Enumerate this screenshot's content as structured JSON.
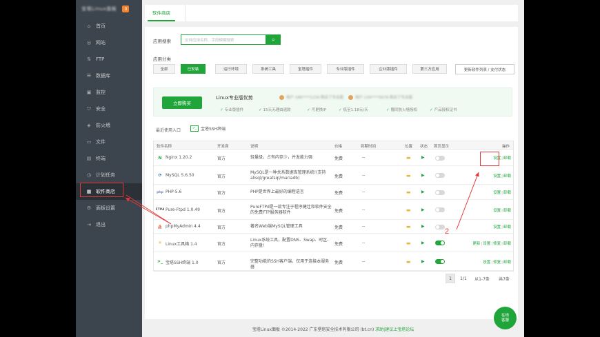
{
  "brand": {
    "name": "宝塔Linux面板",
    "badge": "0"
  },
  "sidebar": {
    "items": [
      {
        "label": "首页",
        "icon": "home-icon",
        "glyph": "⌂"
      },
      {
        "label": "网站",
        "icon": "globe-icon",
        "glyph": "◎"
      },
      {
        "label": "FTP",
        "icon": "ftp-icon",
        "glyph": "⇅"
      },
      {
        "label": "数据库",
        "icon": "database-icon",
        "glyph": "☰"
      },
      {
        "label": "监控",
        "icon": "monitor-icon",
        "glyph": "▣"
      },
      {
        "label": "安全",
        "icon": "shield-icon",
        "glyph": "⛉"
      },
      {
        "label": "防火墙",
        "icon": "firewall-icon",
        "glyph": "◈"
      },
      {
        "label": "文件",
        "icon": "folder-icon",
        "glyph": "▭"
      },
      {
        "label": "终端",
        "icon": "terminal-icon",
        "glyph": "▤"
      },
      {
        "label": "计划任务",
        "icon": "clock-icon",
        "glyph": "◷"
      },
      {
        "label": "软件商店",
        "icon": "apps-icon",
        "glyph": "▦"
      },
      {
        "label": "面板设置",
        "icon": "gear-icon",
        "glyph": "⚙"
      },
      {
        "label": "退出",
        "icon": "logout-icon",
        "glyph": "⇥"
      }
    ]
  },
  "tabs": {
    "active": "软件商店"
  },
  "search": {
    "label": "应用搜索",
    "placeholder": "支持应用名称、字段模糊搜索"
  },
  "categories": {
    "label": "应用分类",
    "items": [
      "全部",
      "已安装",
      "运行环境",
      "系统工具",
      "宝塔插件",
      "专业版插件",
      "企业版插件",
      "第三方应用"
    ],
    "active_index": 1,
    "update_button": "更新软件列表 / 支付状态"
  },
  "promo": {
    "buy_button": "立即购买",
    "title": "Linux专业版优势",
    "users": [
      "用户 186****1234 购买了专业版",
      "用户 139****5678 购买了专业版"
    ],
    "features": [
      "专业版插件",
      "15天无理由退款",
      "可更换IP",
      "低至1.18元/天",
      "赠同防火墙授权",
      "产品授权证书"
    ]
  },
  "recent": {
    "label": "最近使用入口",
    "item": "宝塔SSH终端",
    "icon_text": ">_"
  },
  "table": {
    "headers": [
      "软件名称",
      "开发商",
      "说明",
      "价格",
      "到期时间",
      "位置",
      "状态",
      "首页显示",
      "操作"
    ],
    "rows": [
      {
        "icon": "N",
        "icon_color": "#20a53a",
        "name": "Nginx 1.20.2",
        "dev": "官方",
        "desc": "轻量级，占有内存少，并发能力强",
        "price": "免费",
        "expire": "--",
        "display_on": false,
        "ops": [
          "设置",
          "卸载"
        ]
      },
      {
        "icon": "⟳",
        "icon_color": "#2a6ea6",
        "name": "MySQL 5.6.50",
        "dev": "官方",
        "desc": "MySQL是一种关系数据库管理系统!(支持alisql/greatsql/mariadb)",
        "price": "免费",
        "expire": "--",
        "display_on": false,
        "ops": [
          "设置",
          "卸载"
        ]
      },
      {
        "icon": "php",
        "icon_color": "#6c7eb7",
        "name": "PHP-5.6",
        "dev": "官方",
        "desc": "PHP是世界上最好的编程语言",
        "price": "免费",
        "expire": "--",
        "display_on": false,
        "ops": [
          "设置",
          "卸载"
        ]
      },
      {
        "icon": "FTPd",
        "icon_color": "#555555",
        "name": "Pure-Ftpd 1.0.49",
        "dev": "官方",
        "desc": "PureFTPd是一款专注于程序健壮和软件安全的免费FTP服务器软件",
        "price": "免费",
        "expire": "--",
        "display_on": false,
        "ops": [
          "设置",
          "卸载"
        ]
      },
      {
        "icon": "⛵",
        "icon_color": "#e09b3d",
        "name": "phpMyAdmin 4.4",
        "dev": "官方",
        "desc": "著名Web端MySQL管理工具",
        "price": "免费",
        "expire": "--",
        "display_on": false,
        "ops": [
          "设置",
          "卸载"
        ]
      },
      {
        "icon": "✕",
        "icon_color": "#e6a33c",
        "name": "Linux工具箱 1.4",
        "dev": "官方",
        "desc": "Linux系统工具，配置DNS、Swap、时区、内存盘!",
        "price": "免费",
        "expire": "--",
        "display_on": true,
        "ops": [
          "更新",
          "设置",
          "修复",
          "卸载"
        ]
      },
      {
        "icon": ">_",
        "icon_color": "#20a53a",
        "name": "宝塔SSH终端 1.0",
        "dev": "官方",
        "desc": "完整功能的SSH客户端，仅用于连接本服务器",
        "price": "免费",
        "expire": "--",
        "display_on": true,
        "ops": [
          "设置",
          "修复",
          "卸载"
        ]
      }
    ]
  },
  "pagination": {
    "current": "1",
    "pages": "1/1",
    "range": "从1-7条",
    "total": "共7条"
  },
  "footer": {
    "copyright": "宝塔Linux面板 ©2014-2022 广东堡塔安全技术有限公司 (bt.cn)",
    "links": "求助|建议上宝塔论坛"
  },
  "chat": {
    "line1": "在线",
    "line2": "客服"
  },
  "annotation": {
    "label": "2",
    "color": "#e23a3a"
  }
}
